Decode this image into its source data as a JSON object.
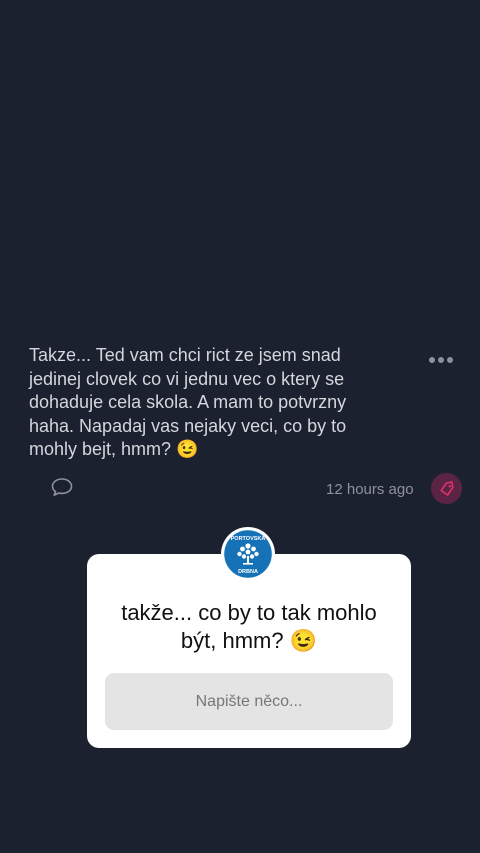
{
  "post": {
    "text": "Takze... Ted vam chci rict ze jsem snad\njedinej clovek co vi jednu vec o ktery se\ndohaduje cela skola. A mam to potvrzny\nhaha. Napadaj vas nejaky veci, co by to\nmohly bejt, hmm? 😉",
    "timestamp": "12 hours ago",
    "more_icon": "more-horizontal-icon",
    "comment_icon": "speech-bubble-icon",
    "tag_icon": "tag-icon"
  },
  "question_card": {
    "avatar_logo_text": "PORTOVSKÁ DRBNA",
    "question": "takže... co by to tak mohlo\nbýt, hmm? 😉",
    "reply_placeholder": "Napište něco..."
  },
  "colors": {
    "background": "#1c2130",
    "post_text": "#d4d6dc",
    "muted": "#8e929e",
    "tag_bg": "#5c2444",
    "tag_fg": "#e0306e",
    "avatar_blue": "#1572b6"
  }
}
